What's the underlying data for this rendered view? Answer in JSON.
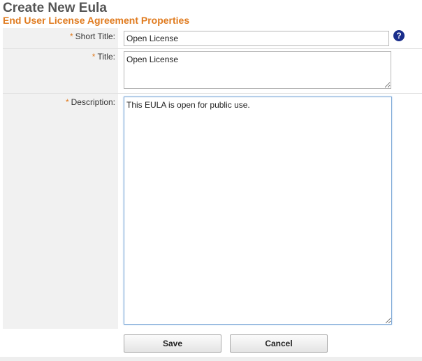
{
  "header": {
    "title": "Create New Eula",
    "subtitle": "End User License Agreement Properties"
  },
  "form": {
    "required_marker": "*",
    "short_title": {
      "label": "Short Title:",
      "value": "Open License"
    },
    "title": {
      "label": "Title:",
      "value": "Open License"
    },
    "description": {
      "label": "Description:",
      "value": "This EULA is open for public use."
    },
    "help_icon": {
      "glyph": "?",
      "icon": "help-icon",
      "color": "#1a2e8c"
    }
  },
  "actions": {
    "save_label": "Save",
    "cancel_label": "Cancel"
  },
  "colors": {
    "accent": "#e07b1f",
    "label_background": "#f1f1f1",
    "heading": "#555555"
  }
}
